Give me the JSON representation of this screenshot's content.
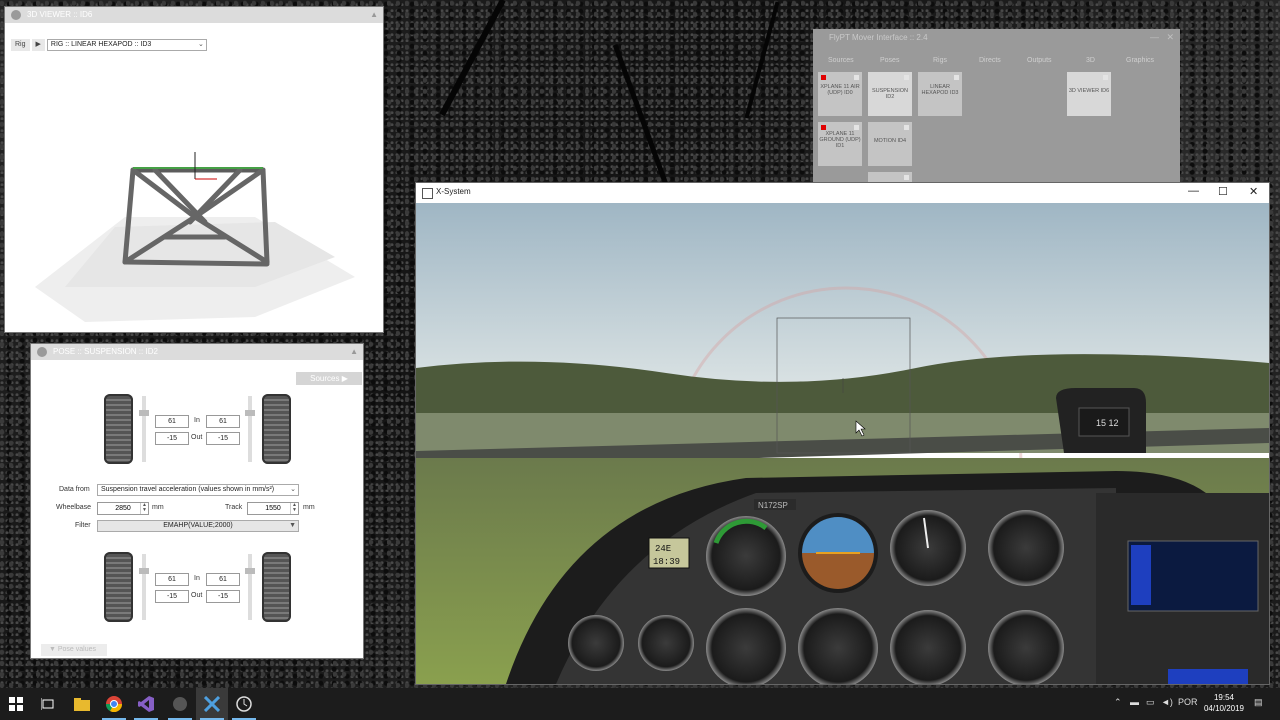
{
  "viewer": {
    "title": "3D VIEWER :: ID6",
    "rig_tag": "Rig",
    "rig_arrow": "▶",
    "rig_select": "RIG :: LINEAR HEXAPOD :: ID3"
  },
  "pose": {
    "title": "POSE :: SUSPENSION :: ID2",
    "sources_label": "Sources ▶",
    "top": {
      "in_left": "61",
      "in_right": "61",
      "out_left": "-15",
      "out_right": "-15",
      "in_label": "In",
      "out_label": "Out"
    },
    "bottom": {
      "in_left": "61",
      "in_right": "61",
      "out_left": "-15",
      "out_right": "-15",
      "in_label": "In",
      "out_label": "Out"
    },
    "data_from_label": "Data from",
    "data_from_value": "Suspension travel acceleration (values shown in mm/s²)",
    "wheelbase_label": "Wheelbase",
    "wheelbase_value": "2850",
    "wheelbase_unit": "mm",
    "track_label": "Track",
    "track_value": "1550",
    "track_unit": "mm",
    "filter_label": "Filter",
    "filter_value": "EMAHP(VALUE;2000)",
    "pose_values_label": "▼  Pose values"
  },
  "mover": {
    "title": "FlyPT Mover Interface :: 2.4",
    "tabs": [
      "Sources",
      "Poses",
      "Rigs",
      "Directs",
      "Outputs",
      "3D",
      "Graphics"
    ],
    "tiles": {
      "xplane_air": "XPLANE 11 AIR (UDP) ID0",
      "xplane_ground": "XPLANE 11 GROUND (UDP) ID1",
      "suspension": "SUSPENSION ID2",
      "motion": "MOTION ID4",
      "linear_hexapod": "LINEAR HEXAPOD ID3",
      "viewer3d": "3D VIEWER ID6"
    }
  },
  "xsystem": {
    "title": "X-System",
    "minimize": "—",
    "maximize": "☐",
    "close": "✕",
    "tail_number": "N172SP",
    "clock_top": "24E",
    "clock_bottom": "18:39",
    "compass": "15  12"
  },
  "taskbar": {
    "lang": "POR",
    "time": "19:54",
    "date": "04/10/2019"
  },
  "colors": {
    "accent": "#76b9ed",
    "status_red": "#e00000"
  }
}
